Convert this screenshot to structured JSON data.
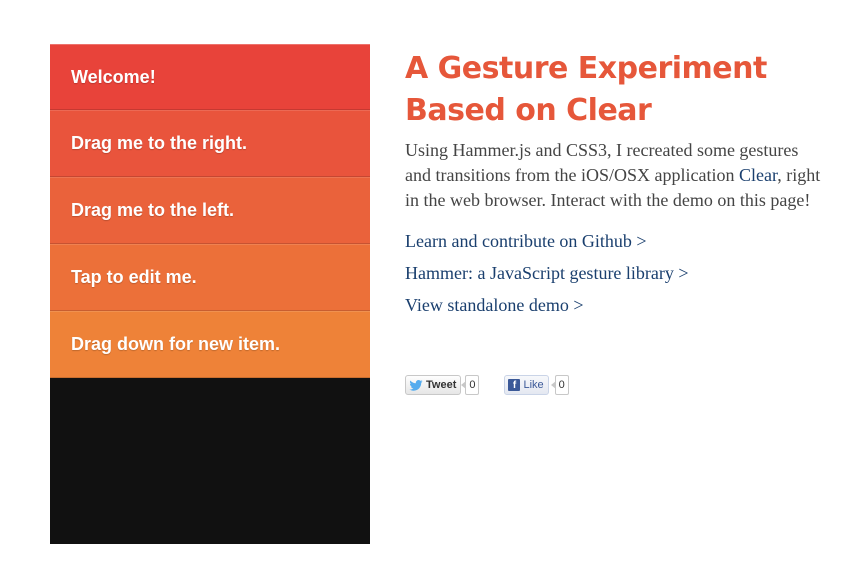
{
  "demo": {
    "items": [
      {
        "label": "Welcome!",
        "color": "#e8433a"
      },
      {
        "label": "Drag me to the right.",
        "color": "#e9543c"
      },
      {
        "label": "Drag me to the left.",
        "color": "#ea623b"
      },
      {
        "label": "Tap to edit me.",
        "color": "#ec7039"
      },
      {
        "label": "Drag down for new item.",
        "color": "#ee8238"
      }
    ],
    "background_color": "#111111"
  },
  "info": {
    "title_line1": "A Gesture Experiment",
    "title_line2": "Based on Clear",
    "title_color": "#e6573a",
    "desc_part1": "Using Hammer.js and CSS3, I recreated some gestures and transitions from the iOS/OSX application ",
    "desc_link": "Clear",
    "desc_part2": ", right in the web browser. Interact with the demo on this page!",
    "links": [
      "Learn and contribute on Github >",
      "Hammer: a JavaScript gesture library >",
      "View standalone demo >"
    ],
    "link_color": "#1a3f6e"
  },
  "social": {
    "tweet_label": "Tweet",
    "tweet_count": "0",
    "like_label": "Like",
    "like_count": "0",
    "tweet_icon": "twitter-bird-icon",
    "like_icon": "facebook-f-icon"
  }
}
